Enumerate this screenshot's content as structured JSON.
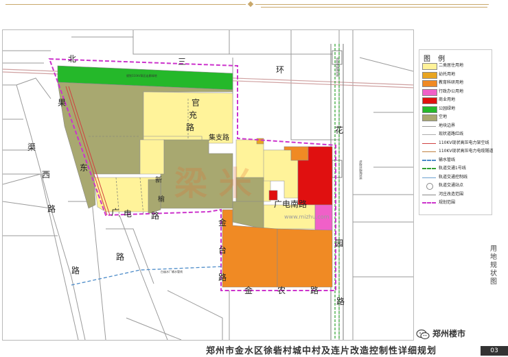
{
  "map": {
    "roads": {
      "bei": "北",
      "san": "三",
      "huan": "环",
      "hua": "花",
      "yuan": "园",
      "lu_east": "路",
      "guo1": "果",
      "dong": "东",
      "qu_xi": "渠",
      "xi": "西",
      "lu_west": "路",
      "lu_west2": "路",
      "guan": "官",
      "chong": "充",
      "lu_guan": "路",
      "jiu_zhi_lu": "集支路",
      "guang_dian_lu": "广电南路",
      "guang": "广",
      "dian": "电",
      "lu_gd": "路",
      "jin_tai": "金",
      "tai": "台",
      "lu_jt": "路",
      "jin_nong": "金",
      "nong": "农",
      "lu_jn": "路",
      "liu_zhi": "榆",
      "kai": "新",
      "lu_lk": "路"
    },
    "annotations": {
      "green_belt": "规划110kV高压走廊绿地",
      "water_pipe": "白庙水厂输水管线",
      "rail_line": "轨道交通规划线",
      "rail_line2": "轨道交通规划线",
      "watermark": "www.mizhu.com"
    }
  },
  "legend": {
    "title": "图 例",
    "items": [
      {
        "label": "二类居住用地",
        "color": "#fff39a",
        "kind": "fill"
      },
      {
        "label": "幼托用地",
        "color": "#e8a420",
        "kind": "fill"
      },
      {
        "label": "教育科研用地",
        "color": "#f08a24",
        "kind": "fill"
      },
      {
        "label": "行政办公用地",
        "color": "#f060c8",
        "kind": "fill"
      },
      {
        "label": "商业用地",
        "color": "#e01010",
        "kind": "fill"
      },
      {
        "label": "公园绿地",
        "color": "#25b82a",
        "kind": "fill"
      },
      {
        "label": "空地",
        "color": "#a8a870",
        "kind": "fill"
      },
      {
        "label": "地块边界",
        "color": "#999999",
        "kind": "line"
      },
      {
        "label": "现状道路红线",
        "color": "#aaaaaa",
        "kind": "line"
      },
      {
        "label": "110KV现状高压电力架空线",
        "color": "#d04040",
        "kind": "line"
      },
      {
        "label": "110KV现状高压电力电缆隧道",
        "color": "#c08040",
        "kind": "line"
      },
      {
        "label": "输水管线",
        "color": "#4a8ac8",
        "kind": "dash"
      },
      {
        "label": "轨道交通1号线",
        "color": "#30a030",
        "kind": "dash"
      },
      {
        "label": "轨道交通控制线",
        "color": "#6aa0d0",
        "kind": "line"
      },
      {
        "label": "轨道交通站点",
        "color": "#888888",
        "kind": "dot"
      },
      {
        "label": "河庄改造范围",
        "color": "#888888",
        "kind": "line"
      },
      {
        "label": "规划范围",
        "color": "#cc33cc",
        "kind": "dash"
      }
    ]
  },
  "side_tag": "用地规状图",
  "footer": {
    "title": "郑州市金水区徐砦村城中村及连片改造控制性详细规划",
    "page": "03"
  },
  "wechat": {
    "name": "郑州楼市"
  },
  "colors": {
    "residential": "#fff39a",
    "vacant": "#a8a870",
    "education": "#f08a24",
    "commercial": "#e01010",
    "admin": "#f060c8",
    "green": "#25b82a",
    "kindergarten": "#e8a420",
    "boundary": "#cc33cc",
    "rail": "#30a030",
    "water": "#4a8ac8",
    "power": "#d04040",
    "gold": "#c9a86a"
  }
}
